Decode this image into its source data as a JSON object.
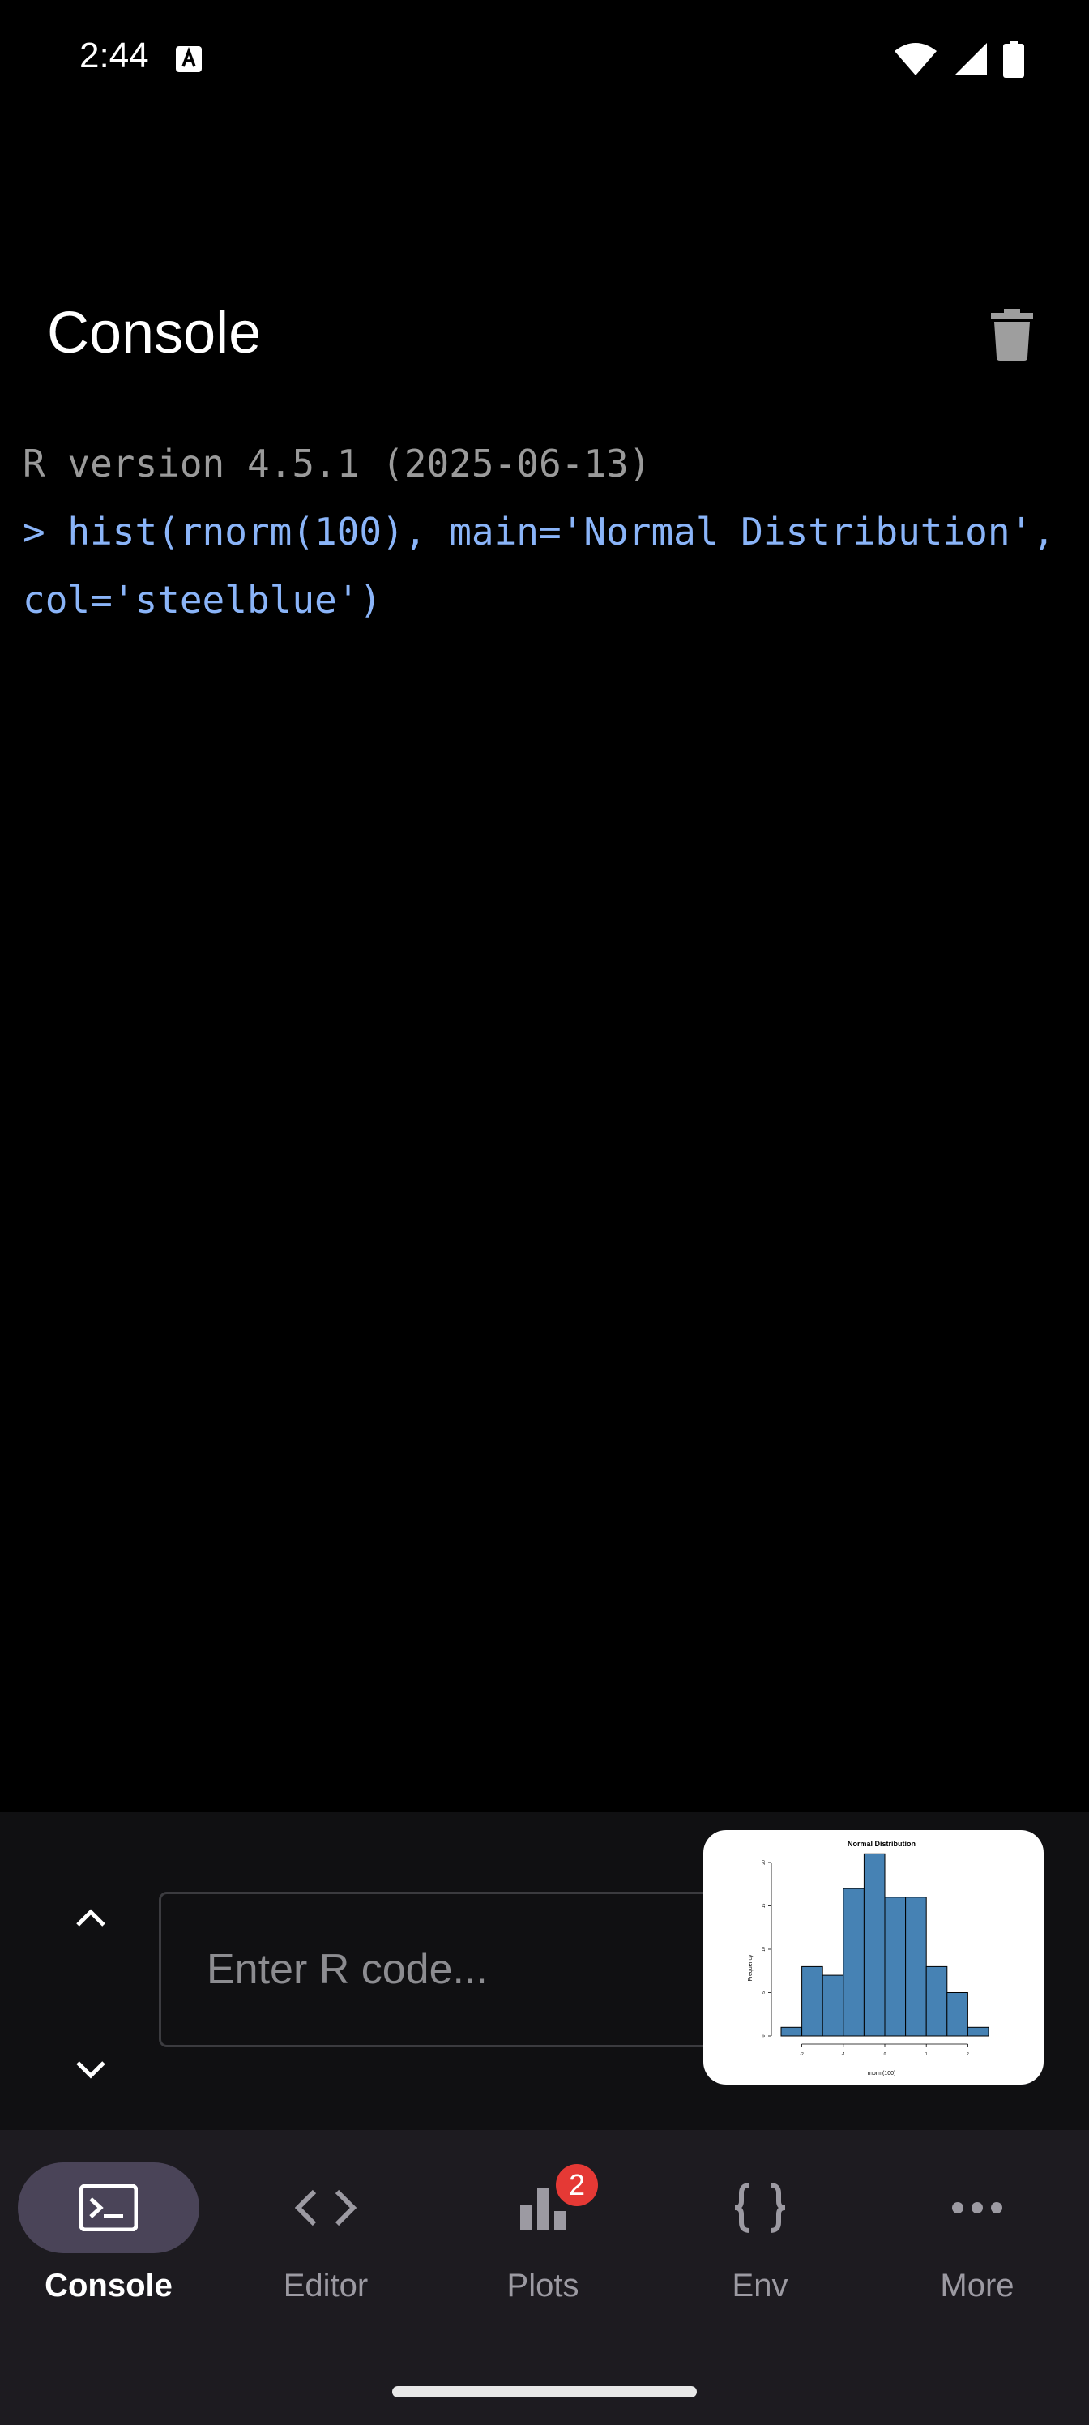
{
  "status_bar": {
    "time": "2:44"
  },
  "header": {
    "title": "Console"
  },
  "console": {
    "version_line": "R version 4.5.1 (2025-06-13)",
    "command_line": "> hist(rnorm(100), main='Normal Distribution', col='steelblue')"
  },
  "input": {
    "placeholder": "Enter R code..."
  },
  "plot_preview": {
    "chart_data": {
      "type": "bar",
      "title": "Normal Distribution",
      "xlabel": "rnorm(100)",
      "ylabel": "Frequency",
      "categories": [
        "-2.5",
        "-2",
        "-1.5",
        "-1",
        "-0.5",
        "0",
        "0.5",
        "1",
        "1.5",
        "2",
        "2.5"
      ],
      "values": [
        1,
        8,
        7,
        17,
        21,
        16,
        16,
        8,
        5,
        1
      ],
      "bins": [
        -2.5,
        -2,
        -1.5,
        -1,
        -0.5,
        0,
        0.5,
        1,
        1.5,
        2,
        2.5
      ],
      "ylim": [
        0,
        20
      ],
      "yticks": [
        "0",
        "5",
        "10",
        "15",
        "20"
      ],
      "xticks": [
        "-2",
        "-1",
        "0",
        "1",
        "2"
      ],
      "bar_color": "#4682b4"
    }
  },
  "nav": {
    "items": [
      {
        "label": "Console",
        "icon": "terminal-icon",
        "active": true
      },
      {
        "label": "Editor",
        "icon": "code-icon",
        "active": false
      },
      {
        "label": "Plots",
        "icon": "bar-chart-icon",
        "active": false,
        "badge": "2"
      },
      {
        "label": "Env",
        "icon": "braces-icon",
        "active": false
      },
      {
        "label": "More",
        "icon": "more-horiz-icon",
        "active": false
      }
    ]
  },
  "colors": {
    "background": "#000000",
    "command_text": "#8ab4f8",
    "version_text": "#9a9a9a",
    "nav_active_pill": "#4a4458",
    "badge": "#e53935"
  }
}
